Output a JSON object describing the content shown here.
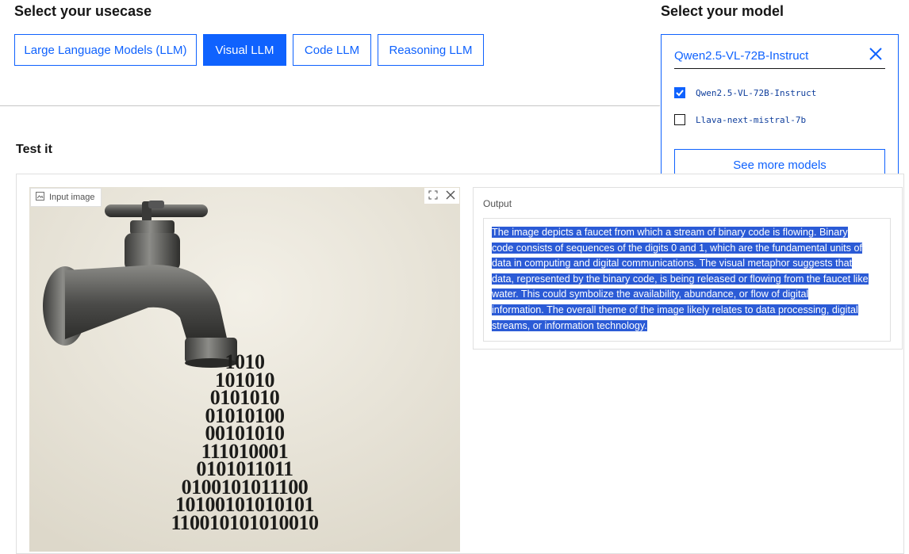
{
  "usecase": {
    "title": "Select your usecase",
    "chips": [
      {
        "label": "Large Language Models (LLM)"
      },
      {
        "label": "Visual LLM"
      },
      {
        "label": "Code LLM"
      },
      {
        "label": "Reasoning LLM"
      }
    ],
    "active_index": 1
  },
  "model": {
    "title": "Select your model",
    "selected": "Qwen2.5-VL-72B-Instruct",
    "options": [
      {
        "label": "Qwen2.5-VL-72B-Instruct",
        "checked": true
      },
      {
        "label": "Llava-next-mistral-7b",
        "checked": false
      }
    ],
    "more_label": "See more models"
  },
  "test": {
    "title": "Test it",
    "image_label": "Input image",
    "image_icon": "image-icon",
    "binary_rows": [
      "1010",
      "101010",
      "0101010",
      "01010100",
      "00101010",
      "111010001",
      "0101011011",
      "0100101011100",
      "10100101010101",
      "110010101010010"
    ],
    "output_label": "Output",
    "output_text": [
      "The image depicts a faucet from which a stream of binary code is flowing. Binary",
      "code consists of sequences of the digits 0 and 1, which are the fundamental units of",
      "data in computing and digital communications. The visual metaphor suggests that",
      "data, represented by the binary code, is being released or flowing from the faucet like",
      "water. This could symbolize the availability, abundance, or flow of digital",
      "information. The overall theme of the image likely relates to data processing, digital",
      "streams, or information technology."
    ]
  },
  "colors": {
    "accent": "#0f62fe",
    "selection": "#2b5bd6"
  }
}
